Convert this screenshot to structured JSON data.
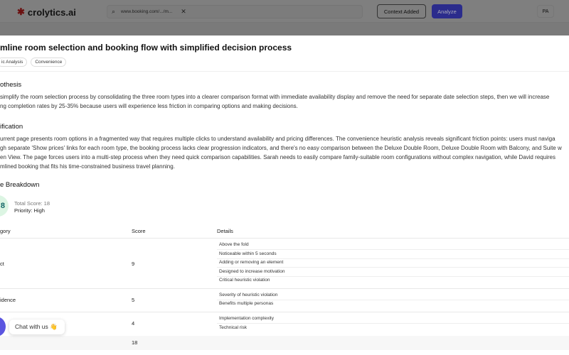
{
  "header": {
    "logo": "crolytics.ai",
    "search_value": "www.booking.com/.../m...",
    "clear": "✕",
    "context_button": "Context Added",
    "analyze_button": "Analyze",
    "avatar": "PA"
  },
  "title": "mline room selection and booking flow with simplified decision process",
  "tags": [
    "ic Analysis",
    "Convenience"
  ],
  "hypothesis": {
    "heading": "othesis",
    "lines": [
      "simplify the room selection process by consolidating the three room types into a clearer comparison format with immediate availability display and remove the need for separate date selection steps, then we will increase",
      "ng completion rates by 25-35% because users will experience less friction in comparing options and making decisions."
    ]
  },
  "justification": {
    "heading": "ification",
    "lines": [
      "urrent page presents room options in a fragmented way that requires multiple clicks to understand availability and pricing differences. The convenience heuristic analysis reveals significant friction points: users must naviga",
      "gh separate 'Show prices' links for each room type, the booking process lacks clear progression indicators, and there's no easy comparison between the Deluxe Double Room, Deluxe Double Room with Balcony, and Suite w",
      "en View. The page forces users into a multi-step process when they need quick comparison capabilities. Sarah needs to easily compare family-suitable room configurations without complex navigation, while David requires",
      "mlined booking that fits his time-constrained business travel planning."
    ]
  },
  "breakdown": {
    "heading": "e Breakdown",
    "score_badge": "8",
    "total_score": "Total Score: 18",
    "priority": "Priority: High",
    "columns": [
      "gory",
      "Score",
      "Details"
    ],
    "rows": [
      {
        "category": "ct",
        "score": "9",
        "details": [
          "Above the fold",
          "Noticeable within 5 seconds",
          "Adding or removing an element",
          "Designed to increase motivation",
          "Critical heuristic violation"
        ]
      },
      {
        "category": "idence",
        "score": "5",
        "details": [
          "Severity of heuristic violation",
          "Benefits multiple personas"
        ]
      },
      {
        "category": "",
        "score": "4",
        "details": [
          "Implementation complexity",
          "Technical risk"
        ]
      }
    ],
    "total": "18"
  },
  "chat": {
    "label": "Chat with us 👋"
  }
}
